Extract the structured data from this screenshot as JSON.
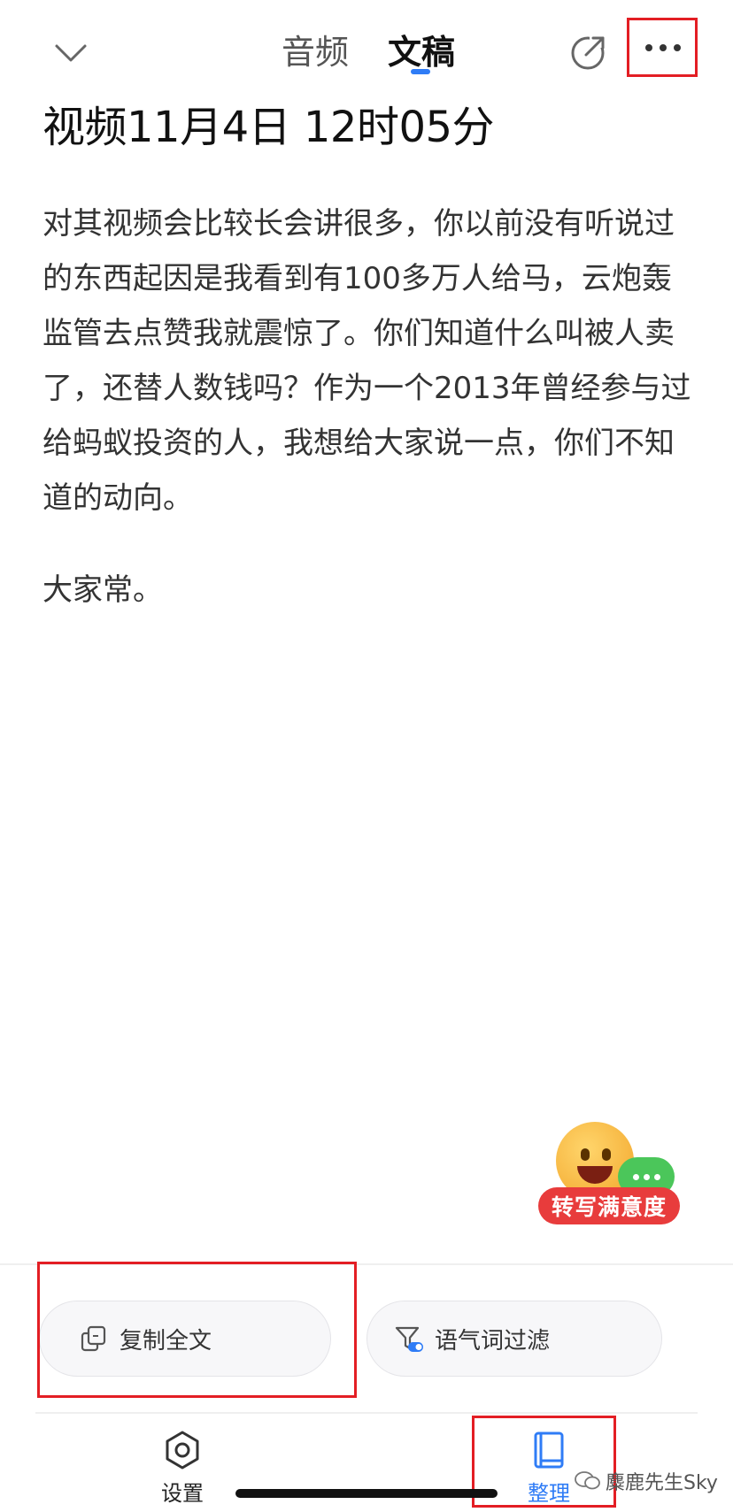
{
  "header": {
    "tabs": [
      {
        "label": "音频",
        "active": false
      },
      {
        "label": "文稿",
        "active": true
      }
    ],
    "accent_color": "#2f7cf6"
  },
  "document": {
    "title": "视频11月4日 12时05分",
    "paragraphs": [
      "对其视频会比较长会讲很多，你以前没有听说过的东西起因是我看到有100多万人给马，云炮轰监管去点赞我就震惊了。你们知道什么叫被人卖了，还替人数钱吗？作为一个2013年曾经参与过给蚂蚁投资的人，我想给大家说一点，你们不知道的动向。",
      "大家常。"
    ]
  },
  "feedback_badge": {
    "label": "转写满意度"
  },
  "actions": {
    "copy_label": "复制全文",
    "filter_label": "语气词过滤"
  },
  "bottom_nav": {
    "settings_label": "设置",
    "organize_label": "整理"
  },
  "watermark": {
    "text": "麋鹿先生Sky"
  },
  "icons": [
    "chevron-down-icon",
    "share-icon",
    "more-icon",
    "copy-icon",
    "filter-icon",
    "settings-icon",
    "book-icon",
    "wechat-icon"
  ],
  "highlight_color": "#e31e24"
}
